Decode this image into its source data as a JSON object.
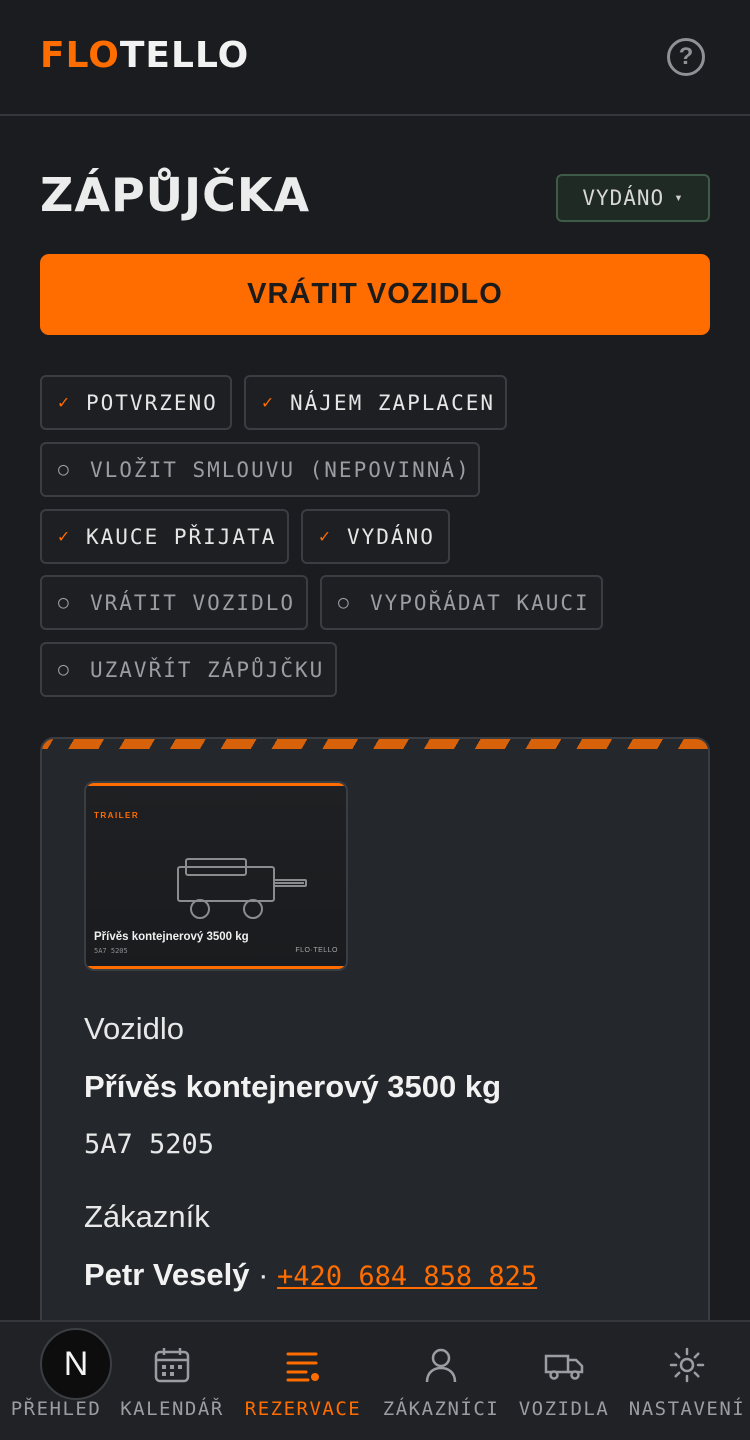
{
  "header": {
    "logo_part_a": "FLO",
    "logo_part_b": "TELLO",
    "help_icon": "question-circle-icon",
    "help_glyph": "?"
  },
  "page": {
    "title": "ZÁPŮJČKA",
    "status": {
      "value": "VYDÁNO",
      "caret": "▾"
    },
    "primary_action": "VRÁTIT VOZIDLO"
  },
  "steps": [
    {
      "label": "POTVRZENO",
      "done": true,
      "mark": "✓"
    },
    {
      "label": "NÁJEM ZAPLACEN",
      "done": true,
      "mark": "✓"
    },
    {
      "label": "VLOŽIT SMLOUVU (NEPOVINNÁ)",
      "done": false,
      "mark": "○"
    },
    {
      "label": "KAUCE PŘIJATA",
      "done": true,
      "mark": "✓"
    },
    {
      "label": "VYDÁNO",
      "done": true,
      "mark": "✓"
    },
    {
      "label": "VRÁTIT VOZIDLO",
      "done": false,
      "mark": "○"
    },
    {
      "label": "VYPOŘÁDAT KAUCI",
      "done": false,
      "mark": "○"
    },
    {
      "label": "UZAVŘÍT ZÁPŮJČKU",
      "done": false,
      "mark": "○"
    }
  ],
  "card": {
    "thumbnail": {
      "tag": "TRAILER",
      "name": "Přívěs kontejnerový 3500 kg",
      "plate": "5A7 5205",
      "brand": "FLO·TELLO"
    },
    "vehicle_label": "Vozidlo",
    "vehicle_name": "Přívěs kontejnerový 3500 kg",
    "vehicle_plate": "5A7 5205",
    "customer_label": "Zákazník",
    "customer_name": "Petr Veselý",
    "separator": "·",
    "customer_phone": "+420 684 858 825"
  },
  "nav": {
    "avatar_letter": "N",
    "items": [
      {
        "label": "PŘEHLED",
        "icon": "avatar-icon"
      },
      {
        "label": "KALENDÁŘ",
        "icon": "calendar-icon"
      },
      {
        "label": "REZERVACE",
        "icon": "list-icon",
        "active": true
      },
      {
        "label": "ZÁKAZNÍCI",
        "icon": "user-icon"
      },
      {
        "label": "VOZIDLA",
        "icon": "truck-icon"
      },
      {
        "label": "NASTAVENÍ",
        "icon": "gear-icon"
      }
    ]
  },
  "colors": {
    "accent": "#ff6d00",
    "background": "#1a1c1f",
    "card": "#24272b"
  }
}
